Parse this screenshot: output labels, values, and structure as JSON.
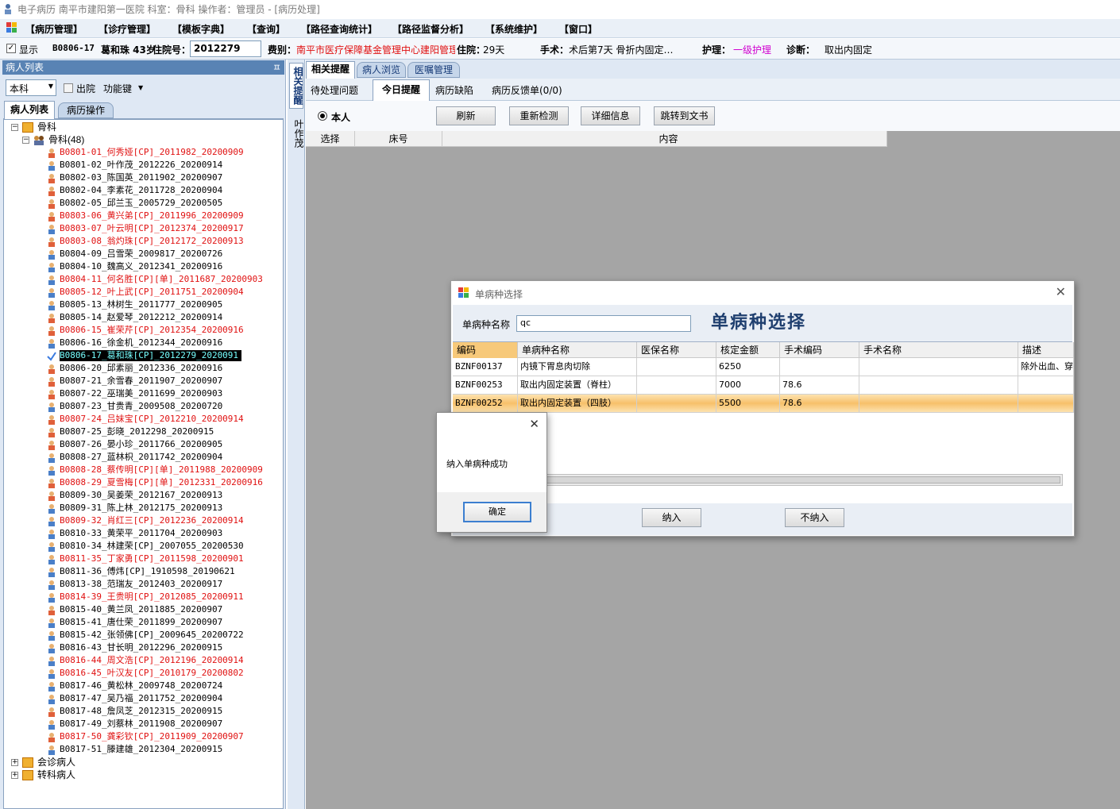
{
  "window": {
    "title": "电子病历  南平市建阳第一医院  科室：骨科  操作者：管理员 - [病历处理]"
  },
  "menu": [
    "【病历管理】",
    "【诊疗管理】",
    "【模板字典】",
    "【查询】",
    "【路径查询统计】",
    "【路径监督分析】",
    "【系统维护】",
    "【窗口】"
  ],
  "infobar": {
    "show_label": "显示",
    "bed": "B0806-17",
    "patient": "葛和珠 43岁",
    "admission_no_label": "住院号：",
    "admission_no": "2012279",
    "fee_label": "费别：",
    "fee_value": "南平市医疗保障基金管理中心建阳管理",
    "stay_label": "住院：",
    "stay_value": "29天",
    "surgery_label": "手术：",
    "surgery_value": "术后第7天  骨折内固定…",
    "nursing_label": "护理：",
    "nursing_value": "一级护理",
    "diagnosis_label": "诊断：",
    "diagnosis_value": "取出内固定"
  },
  "left": {
    "panel_title": "病人列表",
    "dept_select": "本科",
    "discharged_label": "出院",
    "funckey_label": "功能键",
    "tabs": [
      "病人列表",
      "病历操作"
    ],
    "root": "骨科",
    "group": "骨科(48)",
    "patients": [
      {
        "t": "B0801-01_何秀娅[CP]_2011982_20200909",
        "c": "red",
        "g": "f"
      },
      {
        "t": "B0801-02_叶作茂_2012226_20200914",
        "c": "blk",
        "g": "m"
      },
      {
        "t": "B0802-03_陈国英_2011902_20200907",
        "c": "blk",
        "g": "f"
      },
      {
        "t": "B0802-04_李素花_2011728_20200904",
        "c": "blk",
        "g": "f"
      },
      {
        "t": "B0802-05_邱兰玉_2005729_20200505",
        "c": "blk",
        "g": "f"
      },
      {
        "t": "B0803-06_黄兴弟[CP]_2011996_20200909",
        "c": "red",
        "g": "f"
      },
      {
        "t": "B0803-07_叶云明[CP]_2012374_20200917",
        "c": "red",
        "g": "m"
      },
      {
        "t": "B0803-08_翁灼珠[CP]_2012172_20200913",
        "c": "red",
        "g": "f"
      },
      {
        "t": "B0804-09_吕雪荣_2009817_20200726",
        "c": "blk",
        "g": "m"
      },
      {
        "t": "B0804-10_魏高义_2012341_20200916",
        "c": "blk",
        "g": "m"
      },
      {
        "t": "B0804-11_何名胜[CP][单]_2011687_20200903",
        "c": "red",
        "g": "m"
      },
      {
        "t": "B0805-12_叶上武[CP]_2011751_20200904",
        "c": "red",
        "g": "m"
      },
      {
        "t": "B0805-13_林树生_2011777_20200905",
        "c": "blk",
        "g": "m"
      },
      {
        "t": "B0805-14_赵爱琴_2012212_20200914",
        "c": "blk",
        "g": "f"
      },
      {
        "t": "B0806-15_崔荣芹[CP]_2012354_20200916",
        "c": "red",
        "g": "f"
      },
      {
        "t": "B0806-16_徐金机_2012344_20200916",
        "c": "blk",
        "g": "m"
      },
      {
        "t": "B0806-17_葛和珠[CP]_2012279_2020091",
        "c": "sel",
        "g": "chk"
      },
      {
        "t": "B0806-20_邱素丽_2012336_20200916",
        "c": "blk",
        "g": "f"
      },
      {
        "t": "B0807-21_余雪春_2011907_20200907",
        "c": "blk",
        "g": "f"
      },
      {
        "t": "B0807-22_巫瑞美_2011699_20200903",
        "c": "blk",
        "g": "f"
      },
      {
        "t": "B0807-23_甘贵青_2009508_20200720",
        "c": "blk",
        "g": "m"
      },
      {
        "t": "B0807-24_吕妹宝[CP]_2012210_20200914",
        "c": "red",
        "g": "f"
      },
      {
        "t": "B0807-25_彭晓_2012298_20200915",
        "c": "blk",
        "g": "f"
      },
      {
        "t": "B0807-26_晏小珍_2011766_20200905",
        "c": "blk",
        "g": "f"
      },
      {
        "t": "B0808-27_蓝林枳_2011742_20200904",
        "c": "blk",
        "g": "m"
      },
      {
        "t": "B0808-28_蔡传明[CP][单]_2011988_20200909",
        "c": "red",
        "g": "m"
      },
      {
        "t": "B0808-29_夏雪梅[CP][单]_2012331_20200916",
        "c": "red",
        "g": "f"
      },
      {
        "t": "B0809-30_吴姜荣_2012167_20200913",
        "c": "blk",
        "g": "f"
      },
      {
        "t": "B0809-31_陈上林_2012175_20200913",
        "c": "blk",
        "g": "m"
      },
      {
        "t": "B0809-32_肖红三[CP]_2012236_20200914",
        "c": "red",
        "g": "m"
      },
      {
        "t": "B0810-33_黄荣平_2011704_20200903",
        "c": "blk",
        "g": "m"
      },
      {
        "t": "B0810-34_林建荣[CP]_2007055_20200530",
        "c": "blk",
        "g": "m"
      },
      {
        "t": "B0811-35_丁家勇[CP]_2011598_20200901",
        "c": "red",
        "g": "m"
      },
      {
        "t": "B0811-36_傅炜[CP]_1910598_20190621",
        "c": "blk",
        "g": "m"
      },
      {
        "t": "B0813-38_范瑞友_2012403_20200917",
        "c": "blk",
        "g": "m"
      },
      {
        "t": "B0814-39_王贵明[CP]_2012085_20200911",
        "c": "red",
        "g": "m"
      },
      {
        "t": "B0815-40_黄兰凤_2011885_20200907",
        "c": "blk",
        "g": "f"
      },
      {
        "t": "B0815-41_唐仕荣_2011899_20200907",
        "c": "blk",
        "g": "m"
      },
      {
        "t": "B0815-42_张领佛[CP]_2009645_20200722",
        "c": "blk",
        "g": "m"
      },
      {
        "t": "B0816-43_甘长明_2012296_20200915",
        "c": "blk",
        "g": "m"
      },
      {
        "t": "B0816-44_周文浩[CP]_2012196_20200914",
        "c": "red",
        "g": "m"
      },
      {
        "t": "B0816-45_叶汉友[CP]_2010179_20200802",
        "c": "red",
        "g": "m"
      },
      {
        "t": "B0817-46_黄松林_2009748_20200724",
        "c": "blk",
        "g": "m"
      },
      {
        "t": "B0817-47_吴乃福_2011752_20200904",
        "c": "blk",
        "g": "m"
      },
      {
        "t": "B0817-48_詹凤芝_2012315_20200915",
        "c": "blk",
        "g": "f"
      },
      {
        "t": "B0817-49_刘蔡林_2011908_20200907",
        "c": "blk",
        "g": "m"
      },
      {
        "t": "B0817-50_龚彩钦[CP]_2011909_20200907",
        "c": "red",
        "g": "f"
      },
      {
        "t": "B0817-51_滕建雄_2012304_20200915",
        "c": "blk",
        "g": "m"
      }
    ],
    "bottom_nodes": [
      "会诊病人",
      "转科病人"
    ]
  },
  "side_vtabs": {
    "related": "相关提醒",
    "doctor": "叶作茂"
  },
  "main": {
    "tabs1": [
      "相关提醒",
      "病人浏览",
      "医嘱管理"
    ],
    "tabs2": [
      "待处理问题",
      "今日提醒",
      "病历缺陷",
      "病历反馈单(0/0)"
    ],
    "radio_label": "本人",
    "buttons": [
      "刷新",
      "重新检测",
      "详细信息",
      "跳转到文书"
    ],
    "grid_headers": [
      "选择",
      "床号",
      "内容"
    ]
  },
  "dialog": {
    "title": "单病种选择",
    "heading": "单病种选择",
    "search_label": "单病种名称",
    "search_value": "qc",
    "headers": [
      "编码",
      "单病种名称",
      "医保名称",
      "核定金额",
      "手术编码",
      "手术名称",
      "描述"
    ],
    "rows": [
      [
        "BZNF00137",
        "内镜下胃息肉切除",
        "",
        "6250",
        "",
        "",
        "除外出血、穿"
      ],
      [
        "BZNF00253",
        "取出内固定装置（脊柱）",
        "",
        "7000",
        "78.6",
        "",
        ""
      ],
      [
        "BZNF00252",
        "取出内固定装置（四肢）",
        "",
        "5500",
        "78.6",
        "",
        ""
      ]
    ],
    "ok_label": "纳入",
    "cancel_label": "不纳入"
  },
  "msgbox": {
    "message": "纳入单病种成功",
    "ok_label": "确定"
  },
  "colors": {
    "accent": "#5983b4",
    "red_text": "#e01010",
    "selected_row": "#f7c97a"
  }
}
